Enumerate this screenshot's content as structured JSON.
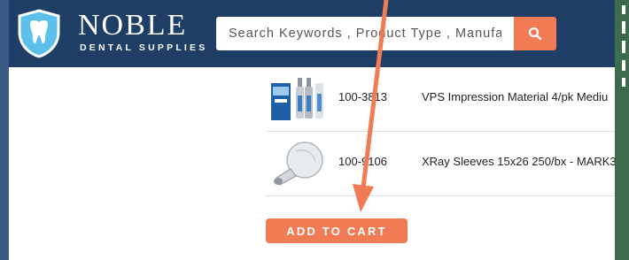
{
  "brand": {
    "name": "NOBLE",
    "tagline": "DENTAL SUPPLIES",
    "logo_icon": "tooth-shield-icon"
  },
  "search": {
    "placeholder": "Search Keywords , Product Type , Manufa",
    "button_icon": "search-icon"
  },
  "products": [
    {
      "sku": "100-3813",
      "description": "VPS Impression Material 4/pk Mediu",
      "thumb_icon": "impression-cartridges-icon"
    },
    {
      "sku": "100-9106",
      "description": "XRay Sleeves 15x26 250/bx - MARK3",
      "thumb_icon": "xray-sleeve-icon"
    }
  ],
  "cart": {
    "button_label": "ADD TO CART"
  },
  "colors": {
    "header_bg": "#1f3e66",
    "accent": "#f07b54",
    "page_border": "#3b5a86",
    "side_strip": "#3d6b4d"
  },
  "annotation": {
    "arrow_color": "#f07b54"
  }
}
